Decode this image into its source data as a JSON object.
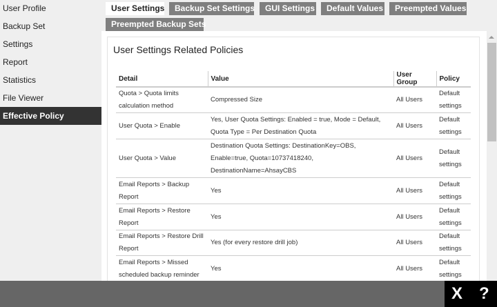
{
  "sidebar": {
    "items": [
      {
        "label": "User Profile"
      },
      {
        "label": "Backup Set"
      },
      {
        "label": "Settings"
      },
      {
        "label": "Report"
      },
      {
        "label": "Statistics"
      },
      {
        "label": "File Viewer"
      },
      {
        "label": "Effective Policy",
        "active": true
      }
    ]
  },
  "tabs": [
    {
      "label": "User Settings",
      "active": true
    },
    {
      "label": "Backup Set Settings"
    },
    {
      "label": "GUI Settings"
    },
    {
      "label": "Default Values"
    },
    {
      "label": "Preempted Values"
    },
    {
      "label": "Preempted Backup Sets"
    }
  ],
  "panel": {
    "title": "User Settings Related Policies",
    "columns": [
      "Detail",
      "Value",
      "User Group",
      "Policy"
    ],
    "rows": [
      [
        "Quota > Quota limits calculation method",
        "Compressed Size",
        "All Users",
        "Default settings"
      ],
      [
        "User Quota > Enable",
        "Yes, User Quota Settings: Enabled = true, Mode = Default, Quota Type = Per Destination Quota",
        "All Users",
        "Default settings"
      ],
      [
        "User Quota > Value",
        "Destination Quota Settings: DestinationKey=OBS, Enable=true, Quota=10737418240, DestinationName=AhsayCBS",
        "All Users",
        "Default settings"
      ],
      [
        "Email Reports > Backup Report",
        "Yes",
        "All Users",
        "Default settings"
      ],
      [
        "Email Reports > Restore Report",
        "Yes",
        "All Users",
        "Default settings"
      ],
      [
        "Email Reports > Restore Drill Report",
        "Yes (for every restore drill job)",
        "All Users",
        "Default settings"
      ],
      [
        "Email Reports > Missed scheduled backup reminder",
        "Yes",
        "All Users",
        "Default settings"
      ]
    ]
  },
  "footer": {
    "close_label": "X",
    "help_label": "?"
  }
}
